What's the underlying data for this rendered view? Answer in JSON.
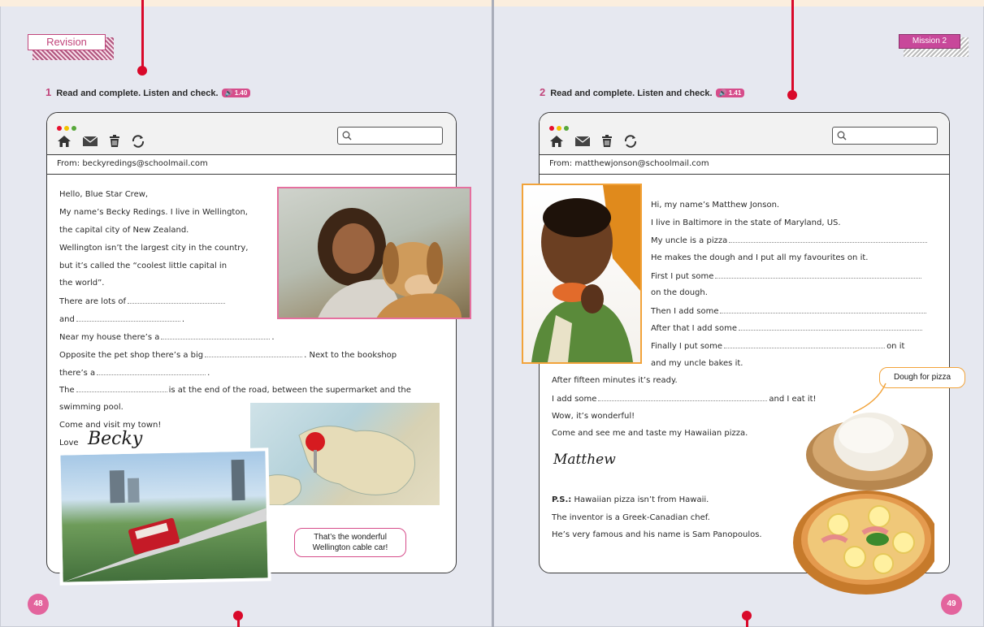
{
  "left_page": {
    "tag": "Revision",
    "page_number": "48",
    "exercise": {
      "number": "1",
      "instruction": "Read and complete. Listen and check.",
      "audio": "1.40"
    },
    "email": {
      "from": "From: beckyredings@schoolmail.com",
      "lines": [
        "Hello, Blue Star Crew,",
        "My name’s Becky Redings. I live in Wellington,",
        "the capital city of New Zealand.",
        "Wellington isn’t the largest city in the country,",
        "but it’s called the “coolest little capital in",
        "the world”.",
        "There are lots of",
        "and",
        "Near my house there’s a",
        "Opposite the pet shop there’s a big",
        ". Next to the bookshop",
        "there’s a",
        "The",
        "is at the end of the road, between the supermarket and the",
        "swimming pool.",
        "Come and visit my town!",
        "Love"
      ],
      "signature": "Becky",
      "bubble": "That’s the wonderful Wellington cable car!"
    }
  },
  "right_page": {
    "tag": "Mission 2",
    "page_number": "49",
    "exercise": {
      "number": "2",
      "instruction": "Read and complete. Listen and check.",
      "audio": "1.41"
    },
    "email": {
      "from": "From: matthewjonson@schoolmail.com",
      "lines": [
        "Hi, my name’s Matthew Jonson.",
        "I live in Baltimore in the state of Maryland, US.",
        "My uncle is a pizza",
        "He makes the dough and I put all my favourites on it.",
        "First I put some",
        "on the dough.",
        "Then I add some",
        "After that I add some",
        "Finally I put some",
        "on it",
        "and my uncle bakes it.",
        "After fifteen minutes it’s ready.",
        "I add some",
        "and I eat it!",
        "Wow, it’s wonderful!",
        "Come and see me and taste my Hawaiian pizza."
      ],
      "signature": "Matthew",
      "ps_label": "P.S.:",
      "ps_lines": [
        "Hawaiian pizza isn’t from Hawaii.",
        "The inventor is a Greek-Canadian chef.",
        "He’s very famous and his name is Sam Panopoulos."
      ],
      "bubble": "Dough for pizza"
    }
  },
  "colors": {
    "pin": "#d9092a",
    "accent": "#d64d8b",
    "page_bg": "#e6e8f0"
  }
}
